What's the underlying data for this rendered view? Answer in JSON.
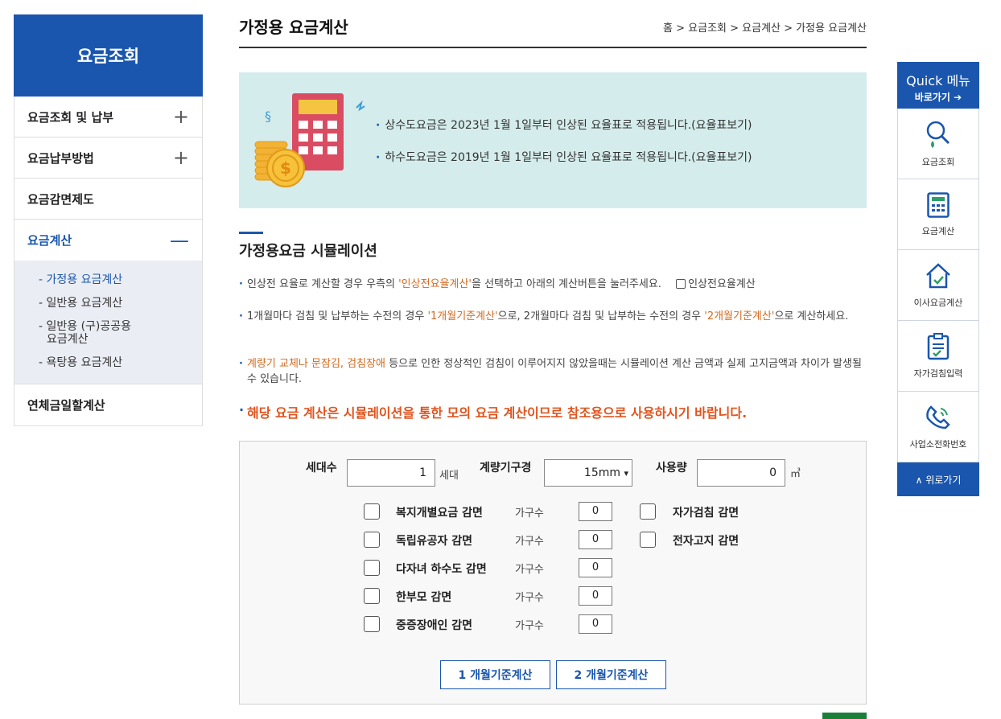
{
  "sidebar": {
    "title": "요금조회",
    "items": [
      {
        "label": "요금조회 및 납부",
        "toggle": "+"
      },
      {
        "label": "요금납부방법",
        "toggle": "+"
      },
      {
        "label": "요금감면제도"
      },
      {
        "label": "요금계산",
        "toggle": "—",
        "active": true
      },
      {
        "label": "연체금일할계산"
      }
    ],
    "sub_items": [
      "- 가정용 요금계산",
      "- 일반용 요금계산",
      "- 일반용 (구)공공용",
      "요금계산",
      "- 욕탕용 요금계산"
    ]
  },
  "header": {
    "title": "가정용 요금계산",
    "breadcrumb": "홈 > 요금조회 > 요금계산 > 가정용 요금계산"
  },
  "notice": {
    "line1": "상수도요금은 2023년 1월 1일부터 인상된 요율표로 적용됩니다.(요율표보기)",
    "line2": "하수도요금은 2019년 1월 1일부터 인상된 요율표로 적용됩니다.(요율표보기)"
  },
  "section": {
    "title": "가정용요금 시뮬레이션",
    "info1_a": "인상전 요율로 계산할 경우 우측의 ",
    "info1_b": "'인상전요율계산'",
    "info1_c": "을 선택하고 아래의 계산버튼을 눌러주세요.",
    "info1_cb_label": "인상전요율계산",
    "info2_a": "1개월마다 검침 및 납부하는 수전의 경우 ",
    "info2_b": "'1개월기준계산'",
    "info2_c": "으로, 2개월마다 검침 및 납부하는 수전의 경우 ",
    "info2_d": "'2개월기준계산'",
    "info2_e": "으로 계산하세요.",
    "info3_a": "계량기 교체나 문잠김, 검침장애",
    "info3_b": " 등으로 인한 정상적인 검침이 이루어지지 않았을때는 시뮬레이션 계산 금액과 실제 고지금액과 차이가 발생될 수 있습니다.",
    "warning": "해당 요금 계산은 시뮬레이션을 통한 모의 요금 계산이므로 참조용으로 사용하시기 바랍니다."
  },
  "form": {
    "households_label": "세대수",
    "households_value": "1",
    "households_unit": "세대",
    "meter_label": "계량기구경",
    "meter_value": "15mm",
    "usage_label": "사용량",
    "usage_value": "0",
    "usage_unit": "㎥",
    "unit_count_label": "가구수",
    "discounts": [
      {
        "label": "복지개별요금 감면",
        "count": "0"
      },
      {
        "label": "독립유공자 감면",
        "count": "0"
      },
      {
        "label": "다자녀 하수도 감면",
        "count": "0"
      },
      {
        "label": "한부모 감면",
        "count": "0"
      },
      {
        "label": "중증장애인 감면",
        "count": "0"
      }
    ],
    "other_discounts": [
      "자가검침 감면",
      "전자고지 감면"
    ],
    "btn_1month": "1 개월기준계산",
    "btn_2month": "2 개월기준계산"
  },
  "quick": {
    "title": "Quick 메뉴",
    "subtitle": "바로가기 ➔",
    "items": [
      {
        "label": "요금조회",
        "icon": "search-drop-icon"
      },
      {
        "label": "요금계산",
        "icon": "calculator-icon"
      },
      {
        "label": "이사요금계산",
        "icon": "house-check-icon"
      },
      {
        "label": "자가검침입력",
        "icon": "clipboard-icon"
      },
      {
        "label": "사업소전화번호",
        "icon": "phone-icon"
      }
    ],
    "top": "∧ 위로가기"
  },
  "colors": {
    "primary": "#1a56ad",
    "notice_bg": "#d5ecec",
    "warning": "#e0541e",
    "highlight": "#d2691e"
  }
}
